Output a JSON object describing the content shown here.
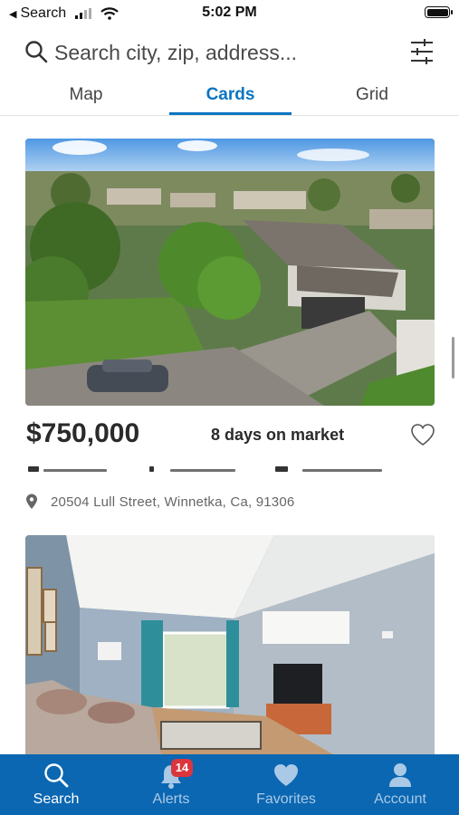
{
  "status_bar": {
    "back_label": "Search",
    "time": "5:02 PM"
  },
  "search": {
    "placeholder": "Search city, zip, address..."
  },
  "tabs": [
    {
      "label": "Map",
      "active": false
    },
    {
      "label": "Cards",
      "active": true
    },
    {
      "label": "Grid",
      "active": false
    }
  ],
  "listings": [
    {
      "price": "$750,000",
      "days_on_market": "8 days on market",
      "address": "20504 Lull Street, Winnetka, Ca, 91306",
      "photo": "aerial-house-exterior"
    },
    {
      "photo": "living-room-interior"
    }
  ],
  "bottom_nav": [
    {
      "label": "Search",
      "icon": "search-icon",
      "active": true
    },
    {
      "label": "Alerts",
      "icon": "bell-icon",
      "active": false,
      "badge": "14"
    },
    {
      "label": "Favorites",
      "icon": "heart-icon",
      "active": false
    },
    {
      "label": "Account",
      "icon": "person-icon",
      "active": false
    }
  ],
  "colors": {
    "accent": "#0b74c2",
    "nav_background": "#0b67b2",
    "badge": "#d9363e"
  }
}
